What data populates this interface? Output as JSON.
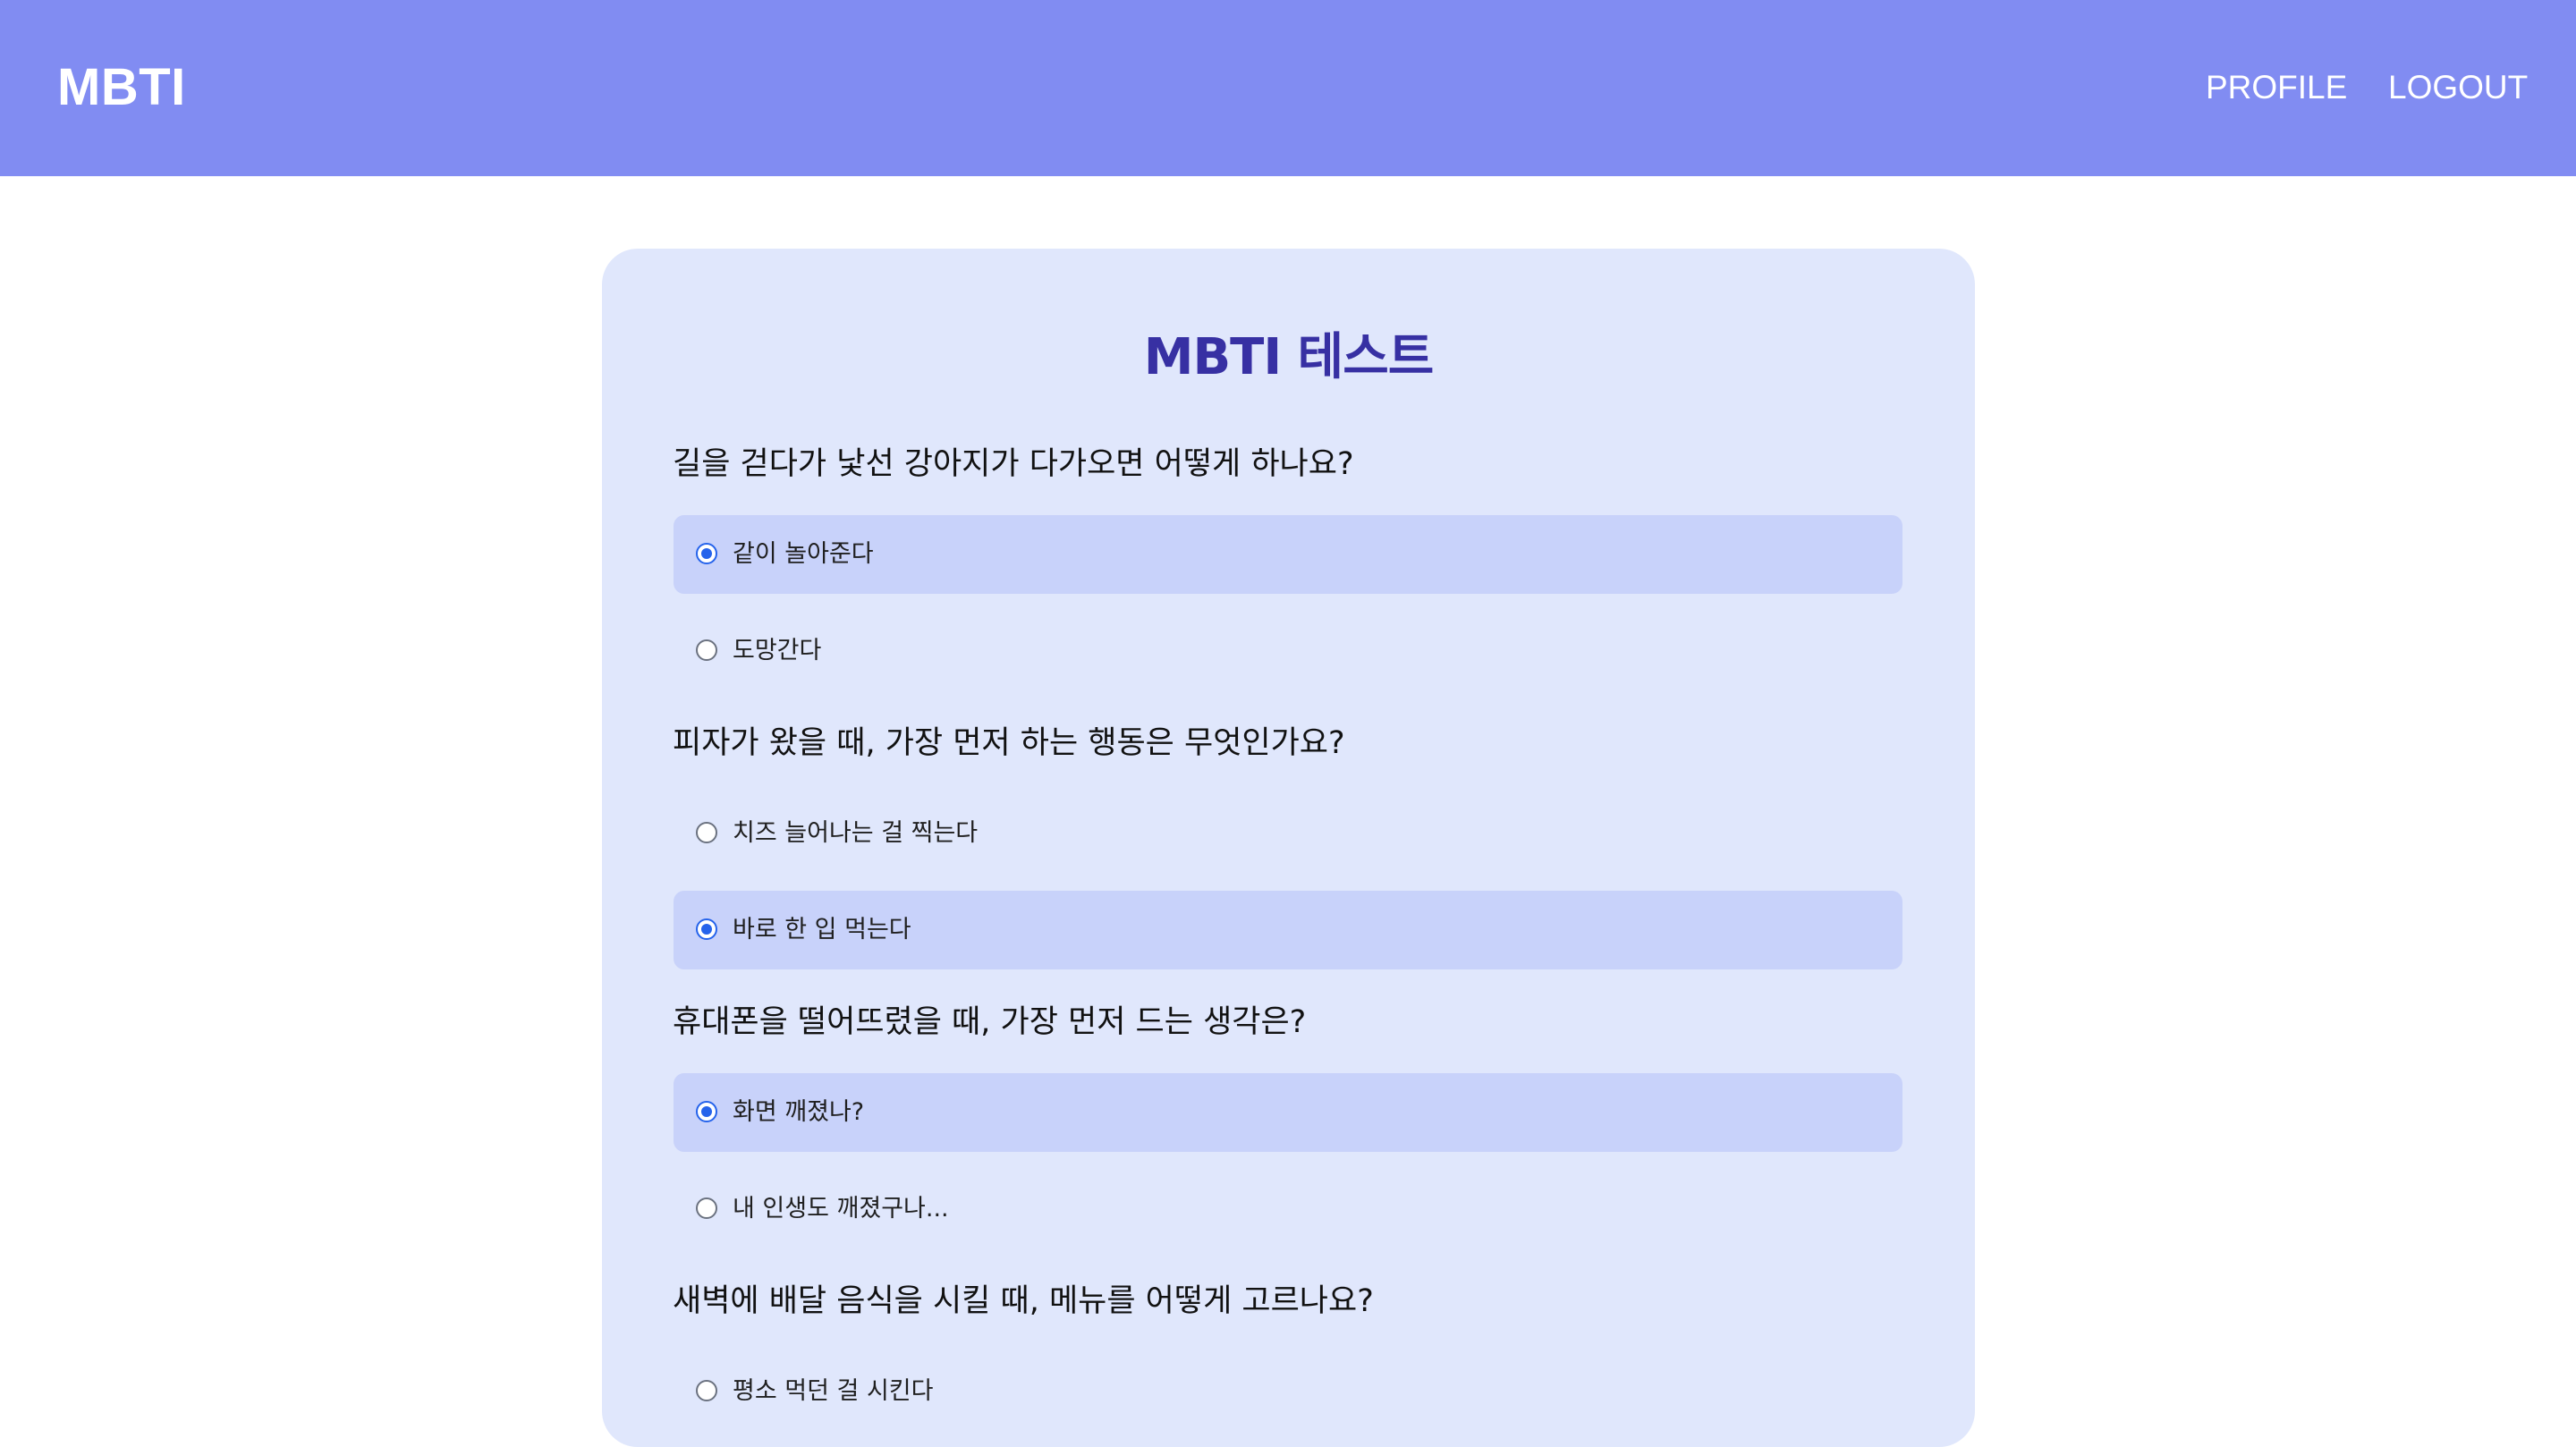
{
  "header": {
    "brand": "MBTI",
    "nav": {
      "profile": "PROFILE",
      "logout": "LOGOUT"
    }
  },
  "test": {
    "title": "MBTI 테스트",
    "questions": [
      {
        "text": "길을 걷다가 낯선 강아지가 다가오면 어떻게 하나요?",
        "options": [
          {
            "label": "같이 놀아준다",
            "selected": true
          },
          {
            "label": "도망간다",
            "selected": false
          }
        ]
      },
      {
        "text": "피자가 왔을 때, 가장 먼저 하는 행동은 무엇인가요?",
        "options": [
          {
            "label": "치즈 늘어나는 걸 찍는다",
            "selected": false
          },
          {
            "label": "바로 한 입 먹는다",
            "selected": true
          }
        ]
      },
      {
        "text": "휴대폰을 떨어뜨렸을 때, 가장 먼저 드는 생각은?",
        "options": [
          {
            "label": "화면 깨졌나?",
            "selected": true
          },
          {
            "label": "내 인생도 깨졌구나...",
            "selected": false
          }
        ]
      },
      {
        "text": "새벽에 배달 음식을 시킬 때, 메뉴를 어떻게 고르나요?",
        "options": [
          {
            "label": "평소 먹던 걸 시킨다",
            "selected": false
          }
        ]
      }
    ]
  },
  "colors": {
    "header_bg": "#818cf2",
    "card_bg": "#e0e7fc",
    "selected_bg": "#c8d2fa",
    "title": "#3730a3",
    "radio_accent": "#2563eb"
  }
}
